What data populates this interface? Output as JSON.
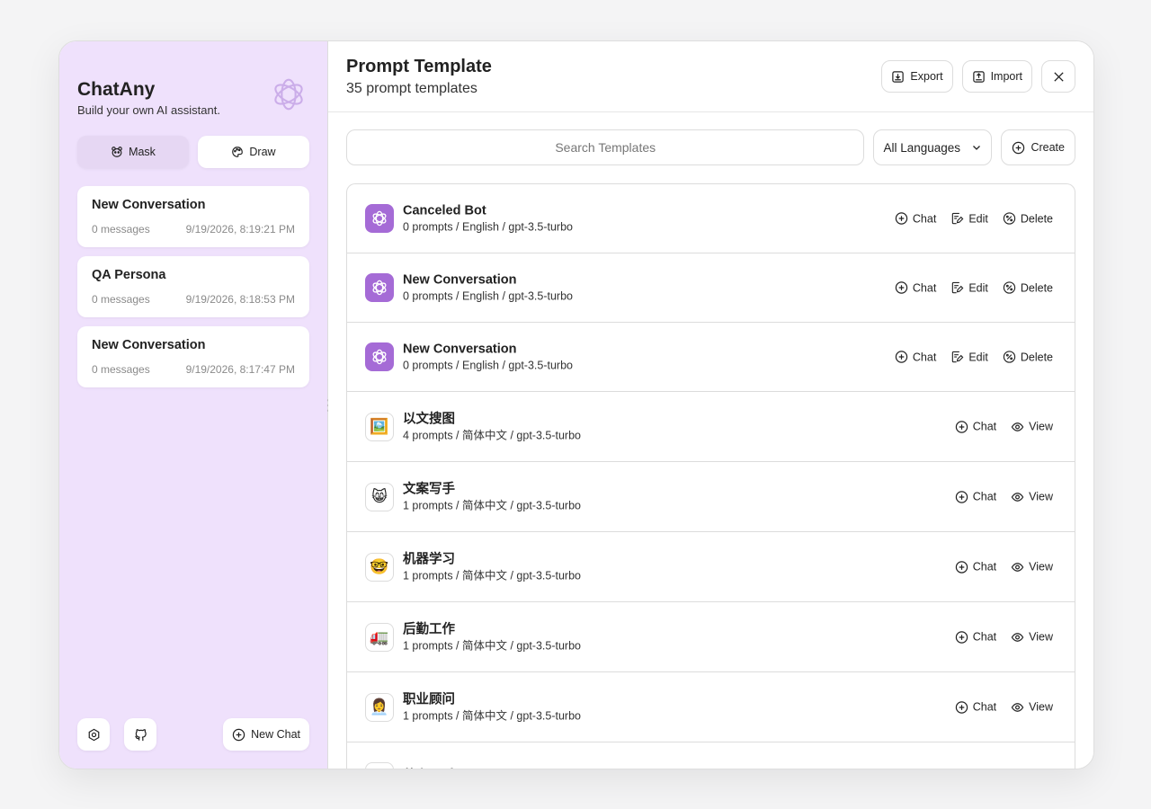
{
  "sidebar": {
    "title": "ChatAny",
    "subtitle": "Build your own AI assistant.",
    "tabs": [
      {
        "label": "Mask",
        "icon": "mask-icon"
      },
      {
        "label": "Draw",
        "icon": "palette-icon"
      }
    ],
    "chats": [
      {
        "title": "New Conversation",
        "count": "0 messages",
        "time": "9/19/2026, 8:19:21 PM"
      },
      {
        "title": "QA Persona",
        "count": "0 messages",
        "time": "9/19/2026, 8:18:53 PM"
      },
      {
        "title": "New Conversation",
        "count": "0 messages",
        "time": "9/19/2026, 8:17:47 PM"
      }
    ],
    "new_chat_label": "New Chat"
  },
  "header": {
    "title": "Prompt Template",
    "subtitle": "35 prompt templates",
    "export_label": "Export",
    "import_label": "Import"
  },
  "toolbar": {
    "search_placeholder": "Search Templates",
    "language": "All Languages",
    "create_label": "Create"
  },
  "templates": [
    {
      "name": "Canceled Bot",
      "info": "0 prompts / English / gpt-3.5-turbo",
      "avatar": "bot",
      "actions": [
        "Chat",
        "Edit",
        "Delete"
      ]
    },
    {
      "name": "New Conversation",
      "info": "0 prompts / English / gpt-3.5-turbo",
      "avatar": "bot",
      "actions": [
        "Chat",
        "Edit",
        "Delete"
      ]
    },
    {
      "name": "New Conversation",
      "info": "0 prompts / English / gpt-3.5-turbo",
      "avatar": "bot",
      "actions": [
        "Chat",
        "Edit",
        "Delete"
      ]
    },
    {
      "name": "以文搜图",
      "info": "4 prompts / 简体中文 / gpt-3.5-turbo",
      "avatar": "🖼️",
      "actions": [
        "Chat",
        "View"
      ]
    },
    {
      "name": "文案写手",
      "info": "1 prompts / 简体中文 / gpt-3.5-turbo",
      "avatar": "😸",
      "actions": [
        "Chat",
        "View"
      ]
    },
    {
      "name": "机器学习",
      "info": "1 prompts / 简体中文 / gpt-3.5-turbo",
      "avatar": "🤓",
      "actions": [
        "Chat",
        "View"
      ]
    },
    {
      "name": "后勤工作",
      "info": "1 prompts / 简体中文 / gpt-3.5-turbo",
      "avatar": "🚛",
      "actions": [
        "Chat",
        "View"
      ]
    },
    {
      "name": "职业顾问",
      "info": "1 prompts / 简体中文 / gpt-3.5-turbo",
      "avatar": "👩‍💼",
      "actions": [
        "Chat",
        "View"
      ]
    },
    {
      "name": "英专写手",
      "info": "",
      "avatar": "",
      "actions": []
    }
  ],
  "colors": {
    "sidebar_bg": "#efe1fc",
    "bot_avatar": "#a56bd6"
  }
}
